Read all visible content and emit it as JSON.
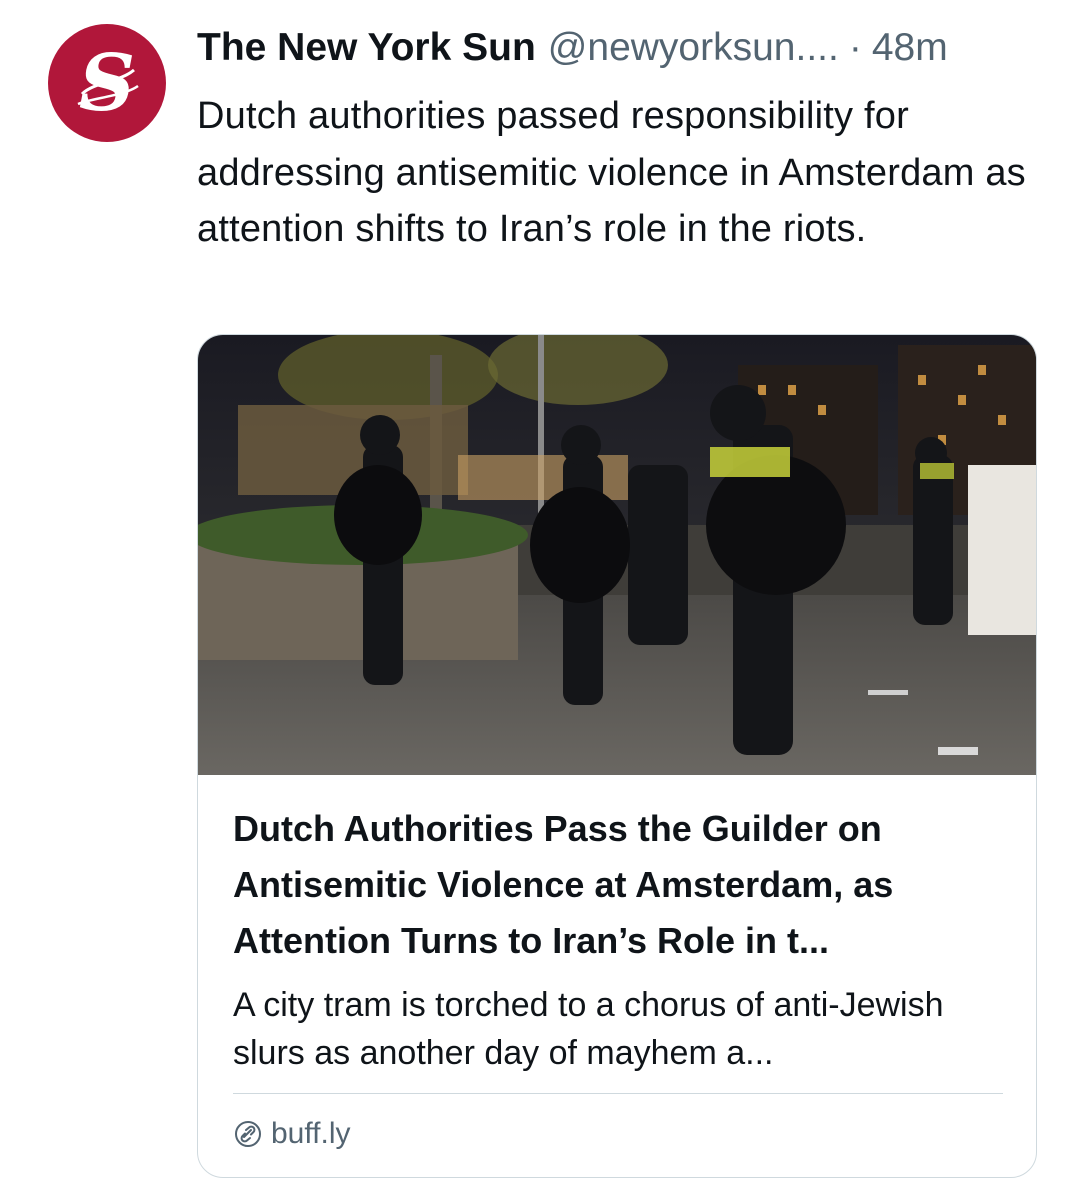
{
  "tweet": {
    "author": {
      "display_name": "The New York Sun",
      "handle": "@newyorksun....",
      "avatar_letter": "S",
      "avatar_color": "#b1173a"
    },
    "separator": "·",
    "timestamp": "48m",
    "text": "Dutch authorities passed responsibility for addressing antisemitic violence in Amsterdam as attention shifts to Iran’s role in the riots."
  },
  "card": {
    "image_subject": "riot-police-with-round-shields-at-night",
    "title": "Dutch Authorities Pass the Guilder on Antisemitic Violence at Amsterdam, as Attention Turns to Iran’s Role in t...",
    "description": "A city tram is torched to a chorus of anti-Jewish slurs as another day of mayhem a...",
    "domain": "buff.ly",
    "domain_icon": "link-icon"
  },
  "colors": {
    "text_primary": "#0f1419",
    "text_secondary": "#536471",
    "border": "#cfd9de"
  }
}
